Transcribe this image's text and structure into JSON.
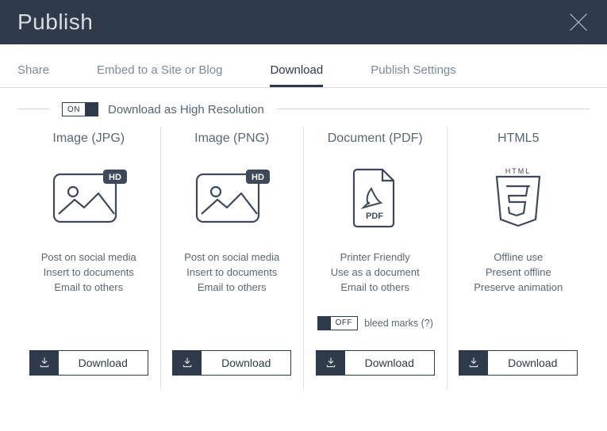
{
  "header": {
    "title": "Publish"
  },
  "tabs": {
    "share": "Share",
    "embed": "Embed to a Site or Blog",
    "download": "Download",
    "settings": "Publish Settings"
  },
  "highres": {
    "toggle_label": "Download as High Resolution",
    "on_text": "ON",
    "off_text": "OFF"
  },
  "cards": {
    "jpg": {
      "title": "Image (JPG)",
      "desc1": "Post on social media",
      "desc2": "Insert to documents",
      "desc3": "Email to others"
    },
    "png": {
      "title": "Image (PNG)",
      "desc1": "Post on social media",
      "desc2": "Insert to documents",
      "desc3": "Email to others"
    },
    "pdf": {
      "title": "Document (PDF)",
      "desc1": "Printer Friendly",
      "desc2": "Use as a document",
      "desc3": "Email to others",
      "bleed_label": "bleed marks (?)"
    },
    "html5": {
      "title": "HTML5",
      "desc1": "Offline use",
      "desc2": "Present offline",
      "desc3": "Preserve animation"
    }
  },
  "download_button": "Download",
  "hd_badge": "HD"
}
